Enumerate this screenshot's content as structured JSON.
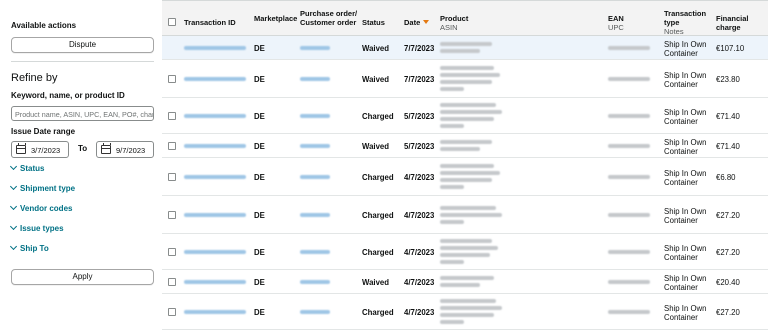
{
  "sidebar": {
    "available_actions": "Available actions",
    "dispute_label": "Dispute",
    "refine_by": "Refine by",
    "keyword_label": "Keyword, name, or product ID",
    "keyword_placeholder": "Product name, ASIN, UPC, EAN, PO#, char",
    "issue_date_label": "Issue Date range",
    "date_from": "3/7/2023",
    "to_label": "To",
    "date_to": "9/7/2023",
    "filters": [
      "Status",
      "Shipment type",
      "Vendor codes",
      "Issue types",
      "Ship To"
    ],
    "apply_label": "Apply"
  },
  "table": {
    "headers": {
      "transaction_id": "Transaction ID",
      "marketplace": "Marketplace",
      "purchase_order": "Purchase order/ Customer order",
      "status": "Status",
      "date": "Date",
      "product": "Product",
      "product_sub": "ASIN",
      "ean": "EAN",
      "ean_sub": "UPC",
      "transaction_type": "Transaction type",
      "transaction_type_sub": "Notes",
      "financial_charge": "Financial charge"
    },
    "rows": [
      {
        "marketplace": "DE",
        "status": "Waived",
        "date": "7/7/2023",
        "type_line1": "Ship In Own",
        "type_line2": "Container",
        "charge": "€107.10",
        "selected": true
      },
      {
        "marketplace": "DE",
        "status": "Waived",
        "date": "7/7/2023",
        "type_line1": "Ship In Own",
        "type_line2": "Container",
        "charge": "€23.80",
        "selected": false
      },
      {
        "marketplace": "DE",
        "status": "Charged",
        "date": "5/7/2023",
        "type_line1": "Ship In Own",
        "type_line2": "Container",
        "charge": "€71.40",
        "selected": false
      },
      {
        "marketplace": "DE",
        "status": "Waived",
        "date": "5/7/2023",
        "type_line1": "Ship In Own",
        "type_line2": "Container",
        "charge": "€71.40",
        "selected": false
      },
      {
        "marketplace": "DE",
        "status": "Charged",
        "date": "4/7/2023",
        "type_line1": "Ship In Own",
        "type_line2": "Container",
        "charge": "€6.80",
        "selected": false
      },
      {
        "marketplace": "DE",
        "status": "Charged",
        "date": "4/7/2023",
        "type_line1": "Ship In Own",
        "type_line2": "Container",
        "charge": "€27.20",
        "selected": false
      },
      {
        "marketplace": "DE",
        "status": "Charged",
        "date": "4/7/2023",
        "type_line1": "Ship In Own",
        "type_line2": "Container",
        "charge": "€27.20",
        "selected": false
      },
      {
        "marketplace": "DE",
        "status": "Waived",
        "date": "4/7/2023",
        "type_line1": "Ship In Own",
        "type_line2": "Container",
        "charge": "€20.40",
        "selected": false
      },
      {
        "marketplace": "DE",
        "status": "Charged",
        "date": "4/7/2023",
        "type_line1": "Ship In Own",
        "type_line2": "Container",
        "charge": "€27.20",
        "selected": false
      }
    ]
  },
  "colors": {
    "link": "#007185",
    "sort_accent": "#e47911",
    "selected_row": "#edf4fb",
    "header_bg": "#f3f3f3"
  }
}
